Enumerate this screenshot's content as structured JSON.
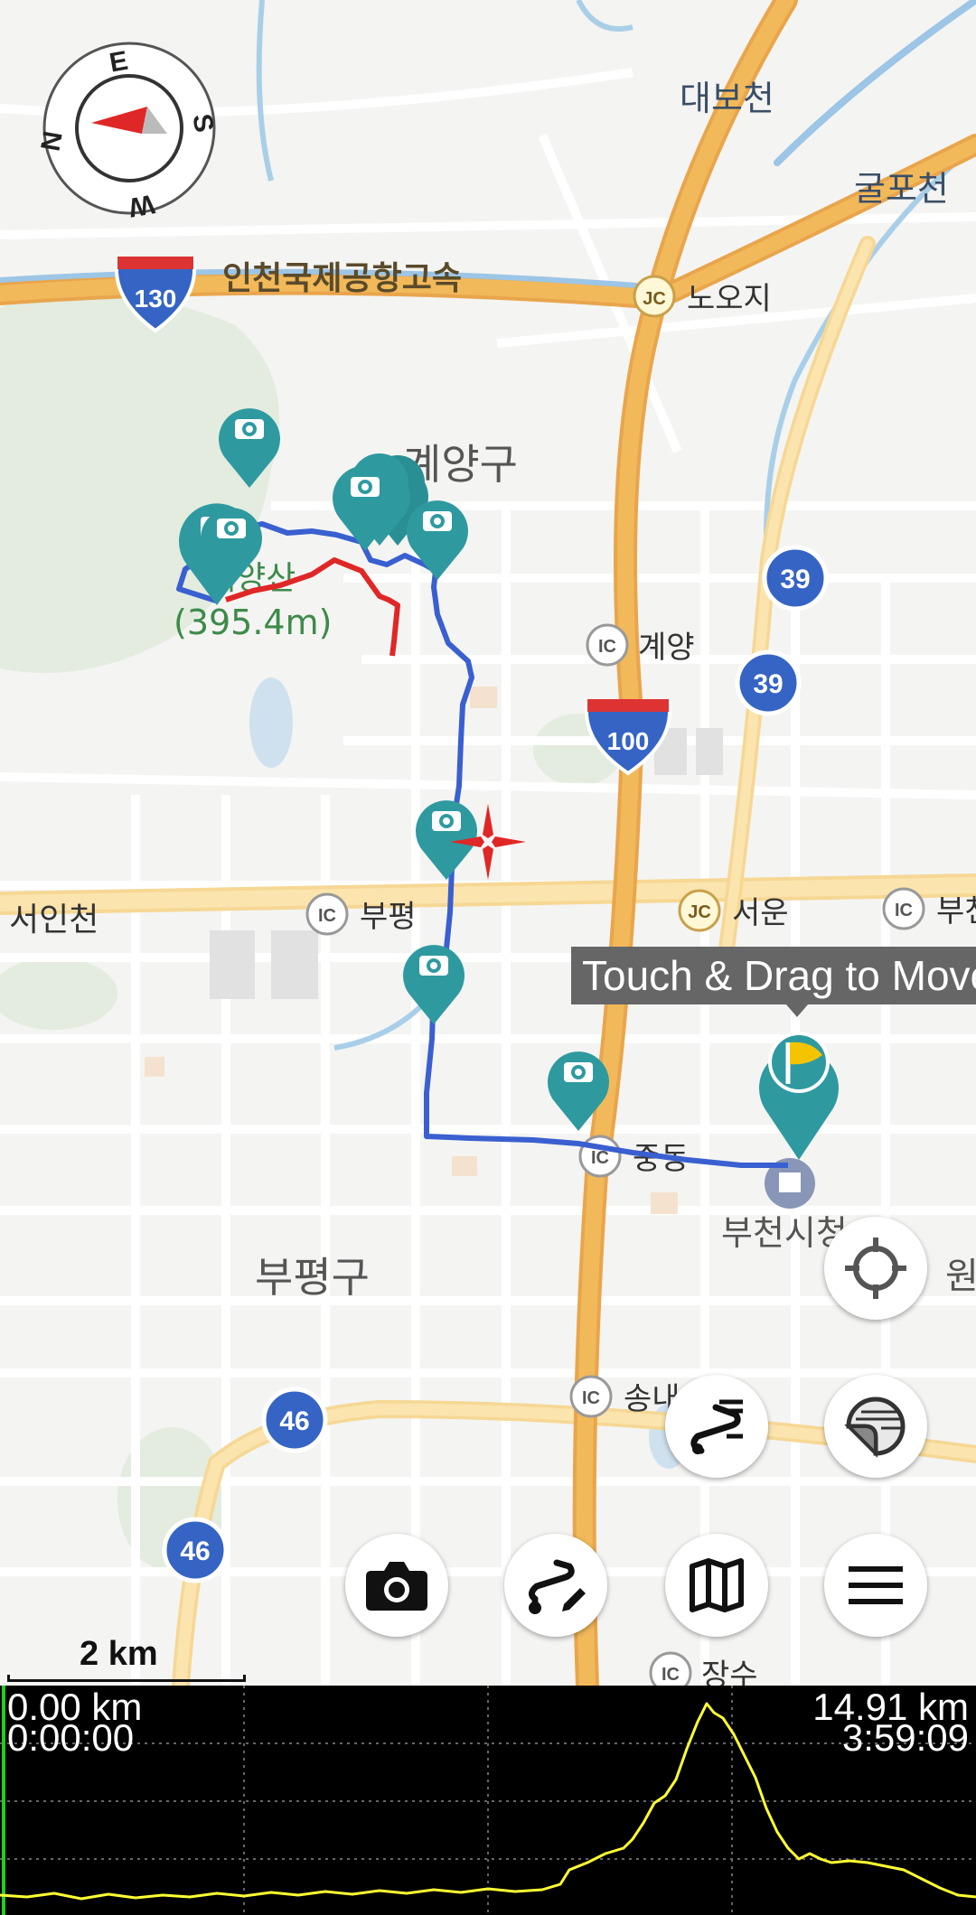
{
  "map": {
    "places": {
      "daebocheon": "대보천",
      "gulpocheon": "굴포천",
      "expressway": "인천국제공항고속",
      "gyeyang_gu": "계양구",
      "mountain_elev": "(395.4m)",
      "mountain_name": "계양산",
      "seoincheon": "서인천",
      "bupyeong_gu": "부평구",
      "bucheon_cityhall": "부천시청",
      "won": "원"
    },
    "junctions": {
      "nooji": "노오지",
      "gyeyang": "계양",
      "bupyeong": "부평",
      "seoun": "서운",
      "bu": "부천",
      "jungdong": "중동",
      "songnae": "송내",
      "jangsu": "장수"
    },
    "junction_badges": {
      "ic": "IC",
      "jc": "JC"
    },
    "route_shields": {
      "r130": "130",
      "r100": "100",
      "r39a": "39",
      "r39b": "39",
      "r46a": "46",
      "r46b": "46"
    },
    "compass": {
      "n": "N",
      "e": "E",
      "s": "S",
      "w": "W"
    },
    "tooltip": "Touch & Drag to Move",
    "scale_label": "2 km"
  },
  "icons": {
    "compass": "compass-icon",
    "locate": "crosshair-icon",
    "track_list": "route-list-icon",
    "layers": "layers-icon",
    "camera": "camera-icon",
    "draw_route": "draw-route-icon",
    "map": "map-icon",
    "menu": "menu-icon",
    "photo_marker": "camera-marker-icon",
    "flag_marker": "flag-marker-icon"
  },
  "colors": {
    "track_blue": "#3a5fd0",
    "track_red": "#e02727",
    "marker_teal": "#2e9aa0",
    "highway_orange": "#f2b95a",
    "elevation_line": "#ffff33"
  },
  "profile": {
    "start_distance": "0.00 km",
    "start_time": "0:00:00",
    "end_distance": "14.91 km",
    "end_time": "3:59:09"
  }
}
